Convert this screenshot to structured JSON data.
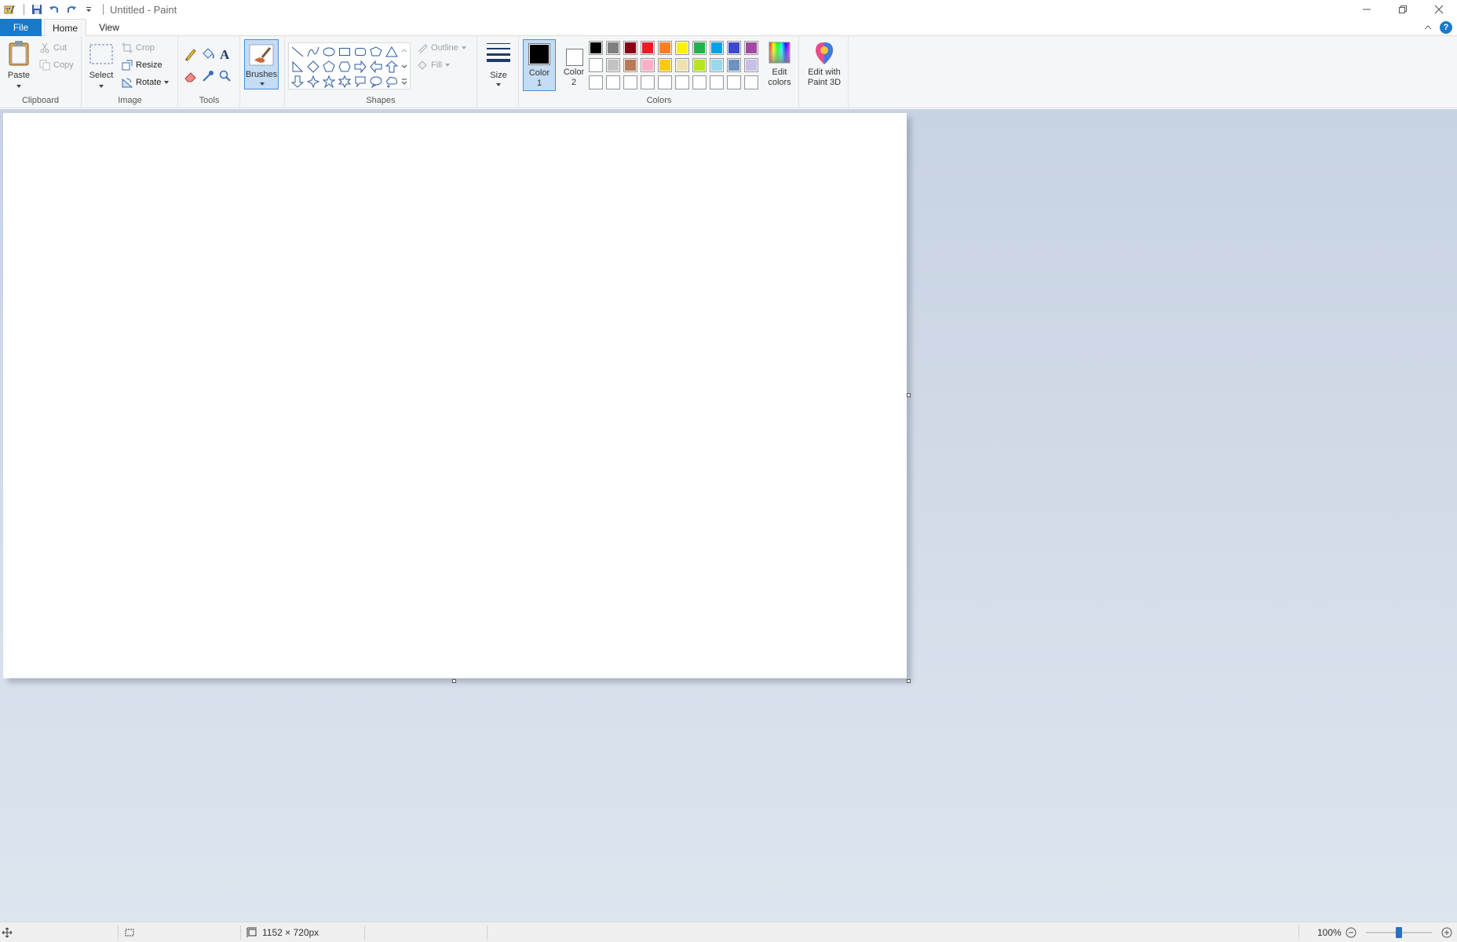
{
  "window": {
    "title": "Untitled - Paint"
  },
  "tabs": {
    "file": "File",
    "home": "Home",
    "view": "View"
  },
  "ribbon": {
    "clipboard": {
      "group_label": "Clipboard",
      "paste": "Paste",
      "cut": "Cut",
      "copy": "Copy"
    },
    "image": {
      "group_label": "Image",
      "select": "Select",
      "crop": "Crop",
      "resize": "Resize",
      "rotate": "Rotate"
    },
    "tools": {
      "group_label": "Tools"
    },
    "brushes": {
      "label": "Brushes"
    },
    "shapes": {
      "group_label": "Shapes",
      "outline": "Outline",
      "fill": "Fill"
    },
    "size": {
      "label": "Size"
    },
    "colors": {
      "group_label": "Colors",
      "color1_line1": "Color",
      "color1_line2": "1",
      "color2_line1": "Color",
      "color2_line2": "2",
      "edit_line1": "Edit",
      "edit_line2": "colors",
      "color1_value": "#000000",
      "color2_value": "#ffffff",
      "palette_row1": [
        "#000000",
        "#7f7f7f",
        "#880015",
        "#ed1c24",
        "#ff7f27",
        "#fff200",
        "#22b14c",
        "#00a2e8",
        "#3f48cc",
        "#a349a4"
      ],
      "palette_row2": [
        "#ffffff",
        "#c3c3c3",
        "#b97a57",
        "#ffaec9",
        "#ffc90e",
        "#efe4b0",
        "#b5e61d",
        "#99d9ea",
        "#7092be",
        "#c8bfe7"
      ],
      "palette_row3": [
        "#ffffff",
        "#ffffff",
        "#ffffff",
        "#ffffff",
        "#ffffff",
        "#ffffff",
        "#ffffff",
        "#ffffff",
        "#ffffff",
        "#ffffff"
      ]
    },
    "paint3d": {
      "line1": "Edit with",
      "line2": "Paint 3D"
    }
  },
  "statusbar": {
    "canvas_size": "1152 × 720px",
    "zoom": "100%",
    "zoom_fraction": 0.5
  }
}
